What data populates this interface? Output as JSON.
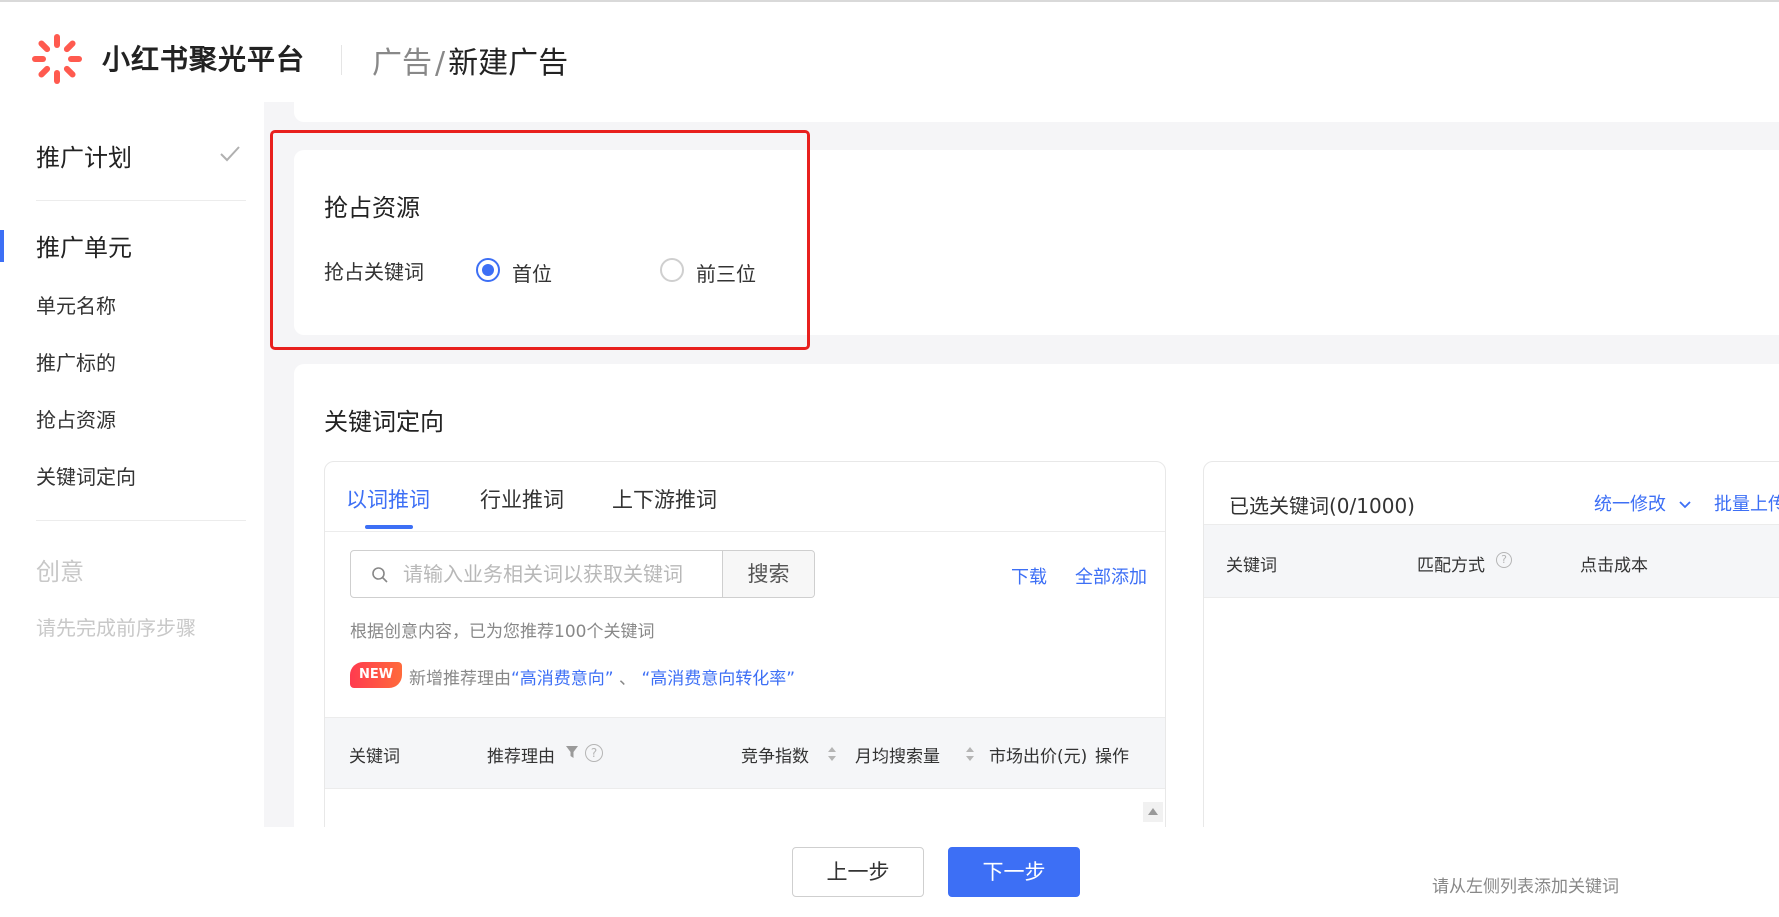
{
  "header": {
    "brand": "小红书聚光平台",
    "breadcrumb_parent": "广告",
    "breadcrumb_sep": "/",
    "breadcrumb_current": "新建广告"
  },
  "sidebar": {
    "plan": "推广计划",
    "unit": "推广单元",
    "unit_name": "单元名称",
    "promo_target": "推广标的",
    "grab_resource": "抢占资源",
    "keyword_targeting": "关键词定向",
    "creative": "创意",
    "creative_hint": "请先完成前序步骤"
  },
  "grab": {
    "title": "抢占资源",
    "label": "抢占关键词",
    "option_first": "首位",
    "option_top3": "前三位",
    "selected": "首位"
  },
  "keywords": {
    "title": "关键词定向",
    "tabs": [
      "以词推词",
      "行业推词",
      "上下游推词"
    ],
    "active_tab": "以词推词",
    "search_placeholder": "请输入业务相关词以获取关键词",
    "search_button": "搜索",
    "download": "下载",
    "add_all": "全部添加",
    "recommend_hint": "根据创意内容，已为您推荐100个关键词",
    "new_badge": "NEW",
    "new_prefix": "新增推荐理由",
    "reason1": "“高消费意向”",
    "new_sep": " 、 ",
    "reason2": "“高消费意向转化率”",
    "columns": {
      "keyword": "关键词",
      "reason": "推荐理由",
      "competition": "竞争指数",
      "monthly": "月均搜索量",
      "price": "市场出价(元)",
      "action": "操作"
    }
  },
  "selected": {
    "title": "已选关键词(0/1000)",
    "bulk_edit": "统一修改",
    "bulk_upload": "批量上传",
    "columns": {
      "keyword": "关键词",
      "match": "匹配方式",
      "cost": "点击成本"
    },
    "empty_tip": "请从左侧列表添加关键词"
  },
  "footer": {
    "prev": "上一步",
    "next": "下一步"
  },
  "colors": {
    "primary": "#3d6ff5",
    "highlight_box": "#e8201e",
    "brand_logo": "#ff5a4f"
  }
}
